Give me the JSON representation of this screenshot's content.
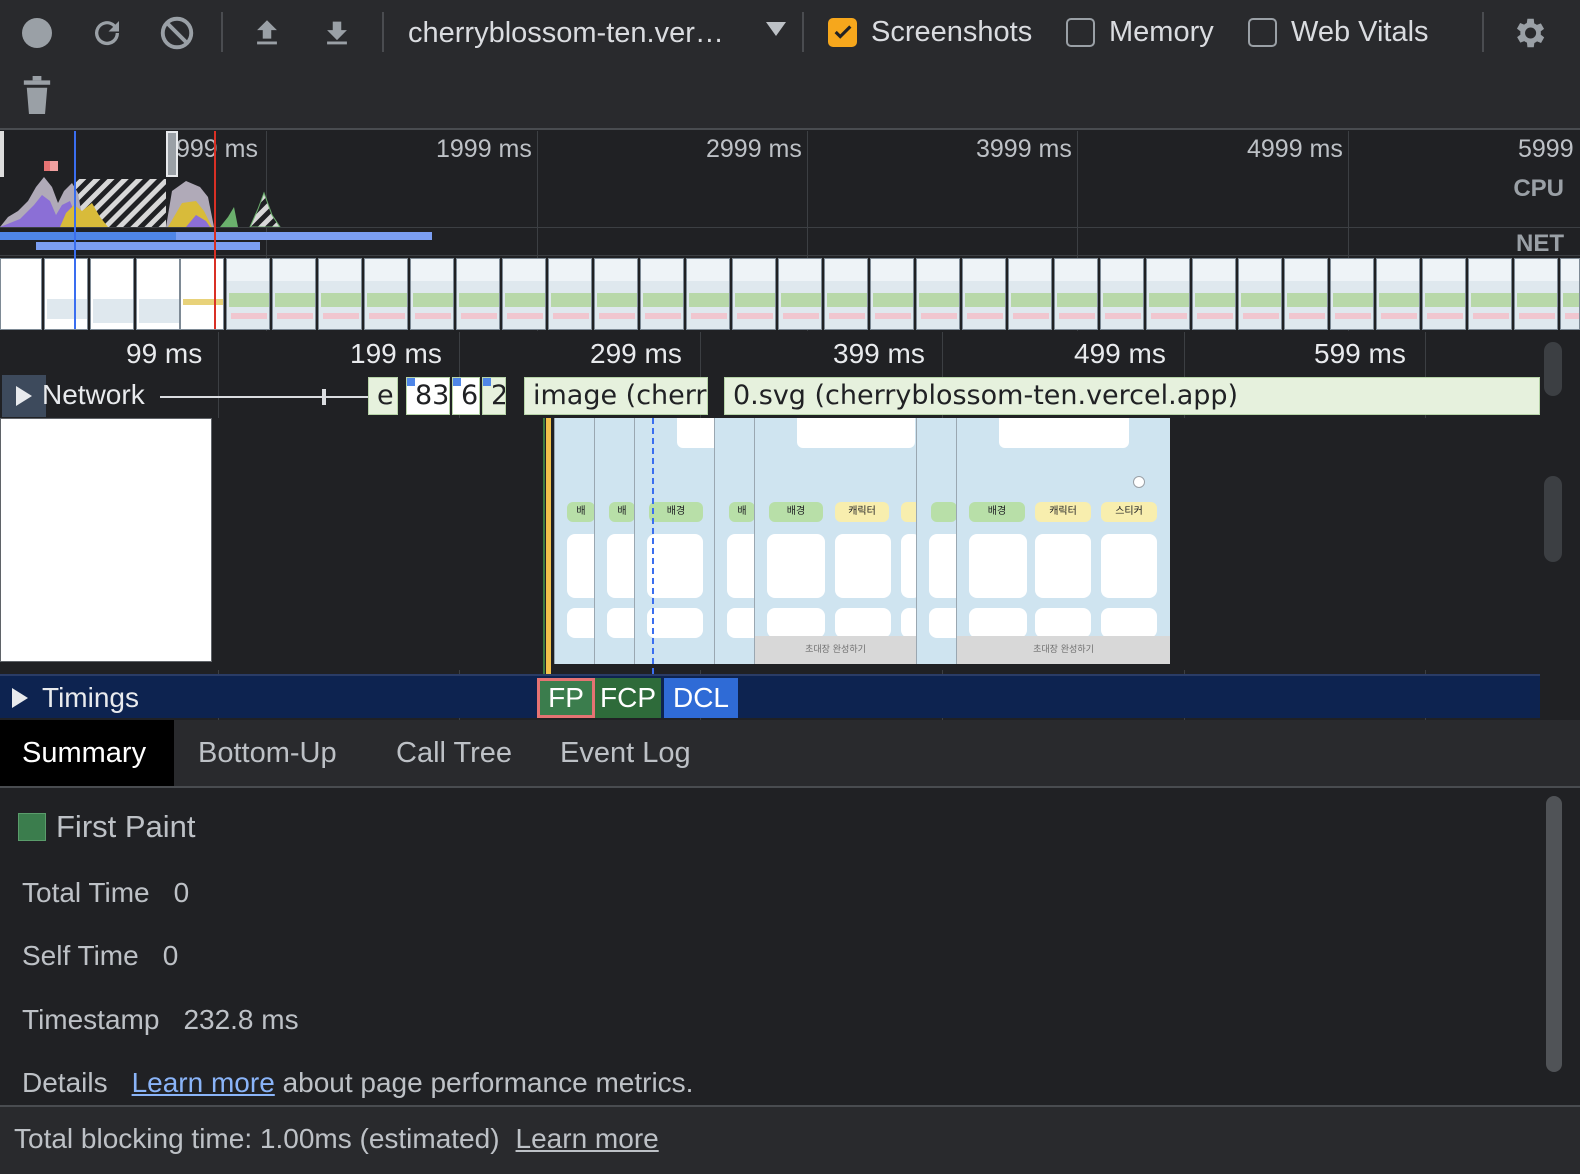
{
  "toolbar": {
    "url": "cherryblossom-ten.ver…",
    "checkboxes": [
      {
        "label": "Screenshots",
        "checked": true
      },
      {
        "label": "Memory",
        "checked": false
      },
      {
        "label": "Web Vitals",
        "checked": false
      }
    ],
    "accent": "#f6a71c"
  },
  "overview": {
    "ticks": [
      "999 ms",
      "1999 ms",
      "2999 ms",
      "3999 ms",
      "4999 ms",
      "5999"
    ],
    "cpu_label": "CPU",
    "net_label": "NET"
  },
  "timeline": {
    "ruler": [
      "99 ms",
      "199 ms",
      "299 ms",
      "399 ms",
      "499 ms",
      "599 ms"
    ],
    "network_label": "Network",
    "requests": [
      {
        "text": "e"
      },
      {
        "text": "83"
      },
      {
        "text": "6"
      },
      {
        "text": "2"
      },
      {
        "text": "image (cherr"
      },
      {
        "text": "0.svg (cherryblossom-ten.vercel.app)"
      }
    ],
    "screenshot_pills": [
      "배",
      "배",
      "배경",
      "배",
      "배경",
      "캐릭터",
      "배경",
      "캐릭터",
      "스티커"
    ],
    "screenshot_footer": "초대장 완성하기",
    "timings_label": "Timings",
    "marks": {
      "fp": "FP",
      "fcp": "FCP",
      "dcl": "DCL"
    }
  },
  "tabs": [
    "Summary",
    "Bottom-Up",
    "Call Tree",
    "Event Log"
  ],
  "summary": {
    "title": "First Paint",
    "swatch_color": "#3b7d4d",
    "total_time_label": "Total Time",
    "total_time": "0",
    "self_time_label": "Self Time",
    "self_time": "0",
    "timestamp_label": "Timestamp",
    "timestamp": "232.8 ms",
    "details_label": "Details",
    "details_link": "Learn more",
    "details_text": "about page performance metrics."
  },
  "footer": {
    "text": "Total blocking time: 1.00ms (estimated)",
    "link": "Learn more"
  }
}
